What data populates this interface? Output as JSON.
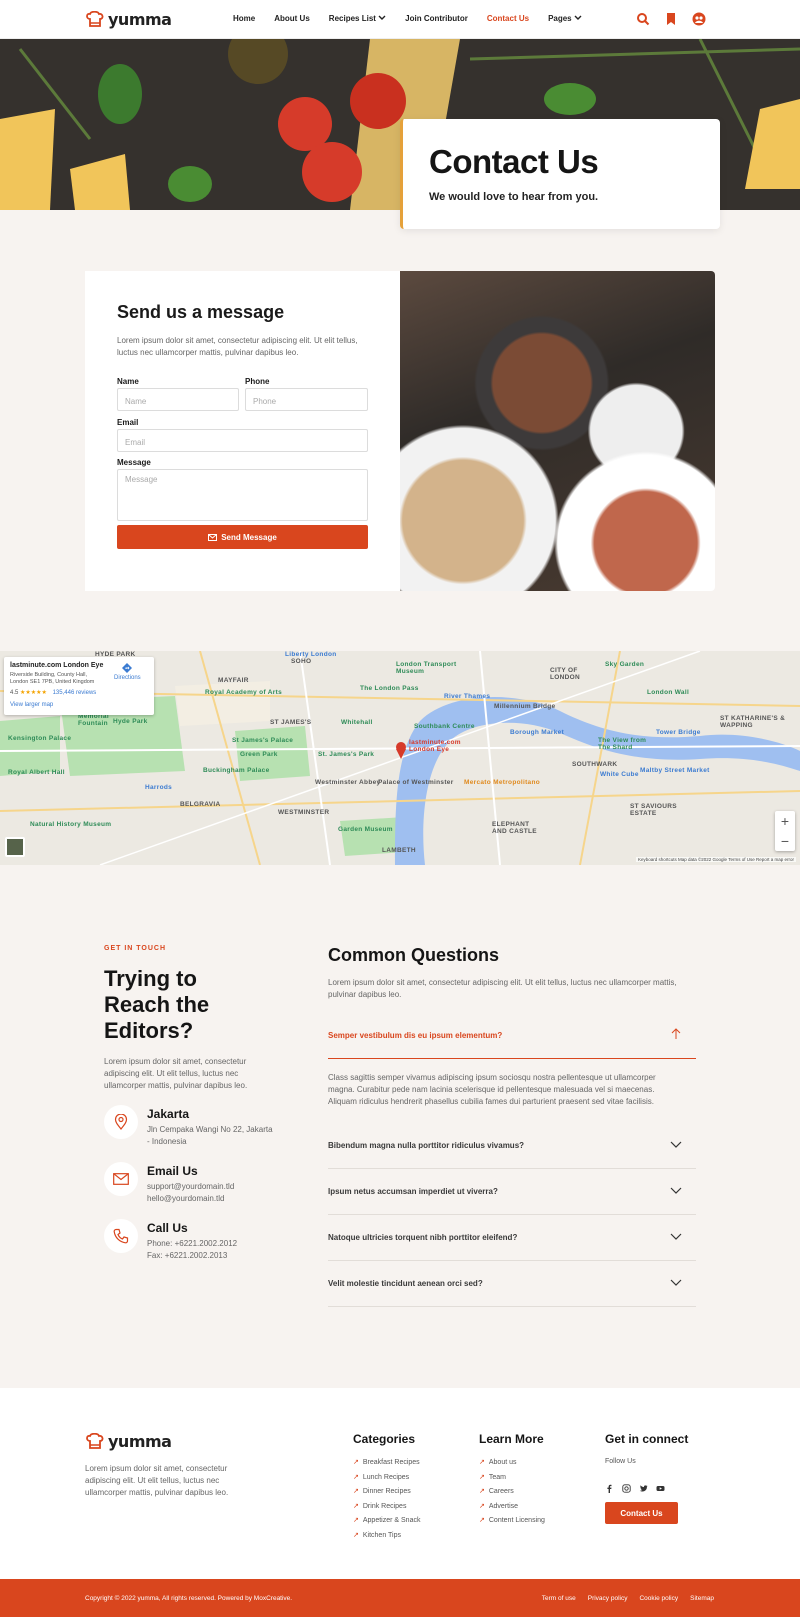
{
  "header": {
    "brand": "yumma",
    "nav": [
      {
        "label": "Home"
      },
      {
        "label": "About Us"
      },
      {
        "label": "Recipes List",
        "has_dropdown": true
      },
      {
        "label": "Join Contributor"
      },
      {
        "label": "Contact Us",
        "active": true
      },
      {
        "label": "Pages",
        "has_dropdown": true
      }
    ],
    "icons": [
      "search-icon",
      "bookmark-icon",
      "user-icon"
    ]
  },
  "hero": {
    "title": "Contact Us",
    "subtitle": "We would love to hear from you."
  },
  "form": {
    "title": "Send us a message",
    "description": "Lorem ipsum dolor sit amet, consectetur adipiscing elit. Ut elit tellus, luctus nec ullamcorper mattis, pulvinar dapibus leo.",
    "name_label": "Name",
    "name_placeholder": "Name",
    "phone_label": "Phone",
    "phone_placeholder": "Phone",
    "email_label": "Email",
    "email_placeholder": "Email",
    "message_label": "Message",
    "message_placeholder": "Message",
    "submit_label": "Send Message"
  },
  "map": {
    "place_name": "lastminute.com London Eye",
    "place_address_1": "Riverside Building, County Hall,",
    "place_address_2": "London SE1 7PB, United Kingdom",
    "rating": "4.5",
    "stars": "★★★★★",
    "reviews": "135,446 reviews",
    "directions": "Directions",
    "larger_map": "View larger map",
    "pin_label_1": "lastminute.com",
    "pin_label_2": "London Eye",
    "labels": {
      "hyde_park_top": "HYDE PARK",
      "soho": "SOHO",
      "mayfair": "MAYFAIR",
      "city_of_london": "CITY OF LONDON",
      "london_wall": "London Wall",
      "st_katharines": "ST KATHARINE'S & WAPPING",
      "st_james": "ST JAMES'S",
      "hyde_park": "Hyde Park",
      "the_london_pass": "The London Pass",
      "royal_academy": "Royal Academy of Arts",
      "southbank": "Southbank Centre",
      "borough_market": "Borough Market",
      "tower_bridge": "Tower Bridge",
      "the_view_from_the_shard": "The View from The Shard",
      "green_park": "Green Park",
      "buckingham_palace": "Buckingham Palace",
      "belgravia": "BELGRAVIA",
      "westminster": "WESTMINSTER",
      "elephant_castle": "ELEPHANT AND CASTLE",
      "st_saviours": "ST SAVIOURS ESTATE",
      "kensington_palace": "Kensington Palace",
      "natural_history_museum": "Natural History Museum",
      "harrods": "Harrods",
      "southwark": "SOUTHWARK",
      "lambeth": "LAMBETH",
      "mercato": "Mercato Metropolitano",
      "garden_museum": "Garden Museum",
      "white_cube": "White Cube",
      "maltby": "Maltby Street Market",
      "palace_westminster": "Palace of Westminster",
      "westminster_abbey": "Westminster Abbey",
      "london_transport_museum": "London Transport Museum",
      "covent_garden": "Sky Garden",
      "royal_albert_hall": "Royal Albert Hall",
      "memorial_fountain": "Memorial Fountain",
      "millennium_bridge": "Millennium Bridge",
      "whitehall": "Whitehall",
      "st_james_park": "St. James's Park",
      "st_james_palace": "St James's Palace",
      "liberty": "Liberty London",
      "river_thames": "River Thames"
    },
    "footer_text": "Keyboard shortcuts   Map data ©2022 Google   Terms of Use   Report a map error",
    "zoom_in": "+",
    "zoom_out": "−"
  },
  "touch": {
    "eyebrow": "GET IN TOUCH",
    "title": "Trying to Reach the Editors?",
    "description": "Lorem ipsum dolor sit amet, consectetur adipiscing elit. Ut elit tellus, luctus nec ullamcorper mattis, pulvinar dapibus leo.",
    "items": [
      {
        "title": "Jakarta",
        "line1": "Jln Cempaka Wangi No 22, Jakarta",
        "line2": "- Indonesia",
        "icon": "location-pin-icon"
      },
      {
        "title": "Email Us",
        "line1": "support@yourdomain.tld",
        "line2": "hello@yourdomain.tld",
        "icon": "envelope-icon"
      },
      {
        "title": "Call Us",
        "line1": "Phone: +6221.2002.2012",
        "line2": "Fax: +6221.2002.2013",
        "icon": "phone-icon"
      }
    ]
  },
  "faq": {
    "title": "Common Questions",
    "description": "Lorem ipsum dolor sit amet, consectetur adipiscing elit. Ut elit tellus, luctus nec ullamcorper mattis, pulvinar dapibus leo.",
    "open_question": "Semper vestibulum dis eu ipsum elementum?",
    "open_answer": "Class sagittis semper vivamus adipiscing ipsum sociosqu nostra pellentesque ut ullamcorper magna. Curabitur pede nam lacinia scelerisque id pellentesque malesuada vel si maecenas. Aliquam ridiculus hendrerit phasellus cubilia fames dui parturient praesent sed vitae facilisis.",
    "questions": [
      "Bibendum magna nulla porttitor ridiculus vivamus?",
      "Ipsum netus accumsan imperdiet ut viverra?",
      "Natoque ultricies torquent nibh porttitor eleifend?",
      "Velit molestie tincidunt aenean orci sed?"
    ]
  },
  "footer": {
    "brand": "yumma",
    "description": "Lorem ipsum dolor sit amet, consectetur adipiscing elit. Ut elit tellus, luctus nec ullamcorper mattis, pulvinar dapibus leo.",
    "categories_title": "Categories",
    "categories": [
      "Breakfast Recipes",
      "Lunch Recipes",
      "Dinner Recipes",
      "Drink Recipes",
      "Appetizer & Snack",
      "Kitchen Tips"
    ],
    "learn_title": "Learn More",
    "learn": [
      "About us",
      "Team",
      "Careers",
      "Advertise",
      "Content Licensing"
    ],
    "connect_title": "Get in connect",
    "follow_label": "Follow Us",
    "socials": [
      "facebook-icon",
      "instagram-icon",
      "twitter-icon",
      "youtube-icon"
    ],
    "button_label": "Contact Us",
    "copyright": "Copyright © 2022 yumma, All rights reserved. Powered by MoxCreative.",
    "bottom_links": [
      "Term of use",
      "Privacy policy",
      "Cookie policy",
      "Sitemap"
    ]
  },
  "colors": {
    "accent": "#d9461e",
    "hero_border": "#e5a13a",
    "background": "#f7f3f0"
  }
}
